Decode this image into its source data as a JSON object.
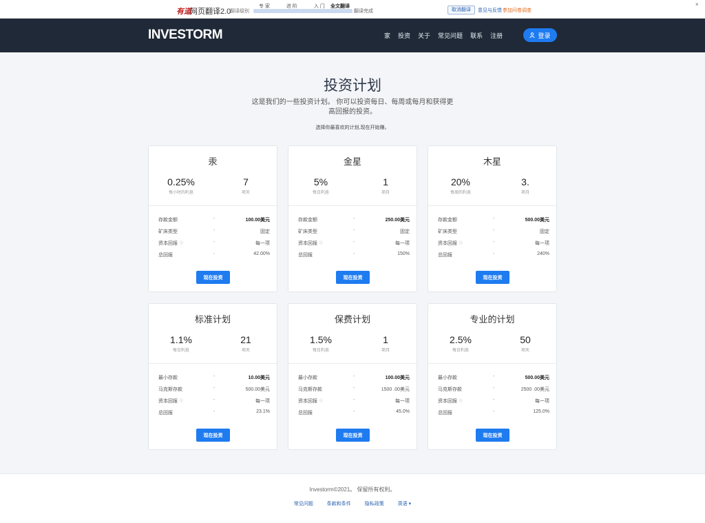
{
  "toolbar": {
    "brand": "有道",
    "brand_sub": "网页翻译2.0",
    "mode": "翻译级别",
    "steps": [
      "专 家",
      "进 阶",
      "入 门"
    ],
    "full_translate": "全文翻译",
    "done": "翻译完成",
    "progress": 1.0,
    "cancel": "取消翻译",
    "feedback": "意见与反馈",
    "survey": "参加问卷调查",
    "close": "×"
  },
  "nav": {
    "logo": "INVESTORM",
    "menu": [
      "家",
      "投资",
      "关于",
      "常见问题",
      "联系",
      "注册"
    ],
    "login": "登录"
  },
  "header": {
    "title": "投资计划",
    "subtitle": "这是我们的一些投资计划。 你可以投资每日、每周或每月和获得更高回报的投资。",
    "choose": "选择你最喜欢的计划,现在开始赚。"
  },
  "plans": [
    {
      "name": "汞",
      "stat1_value": "0.25%",
      "stat1_label": "每小时的利息",
      "stat2_value": "7",
      "stat2_label": "项天",
      "rows": [
        {
          "key": "存款金额",
          "dash": "-",
          "value": "100.00美元",
          "bold": true
        },
        {
          "key": "矿床类型",
          "dash": "-",
          "value": "固定"
        },
        {
          "key": "资本回报",
          "dash": "-",
          "value": "每一项",
          "info": "ⓘ"
        },
        {
          "key": "总回报",
          "dash": "-",
          "value": "42.00%"
        }
      ],
      "button": "现在投资"
    },
    {
      "name": "金星",
      "stat1_value": "5%",
      "stat1_label": "每日利息",
      "stat2_value": "1",
      "stat2_label": "项月",
      "rows": [
        {
          "key": "存款金额",
          "dash": "-",
          "value": "250.00美元",
          "bold": true
        },
        {
          "key": "矿床类型",
          "dash": "-",
          "value": "固定"
        },
        {
          "key": "资本回报",
          "dash": "-",
          "value": "每一项",
          "info": "ⓘ"
        },
        {
          "key": "总回报",
          "dash": "-",
          "value": "150%"
        }
      ],
      "button": "现在投资"
    },
    {
      "name": "木星",
      "stat1_value": "20%",
      "stat1_label": "每周的利息",
      "stat2_value": "3.",
      "stat2_label": "项月",
      "rows": [
        {
          "key": "存款金额",
          "dash": "-",
          "value": "500.00美元",
          "bold": true
        },
        {
          "key": "矿床类型",
          "dash": "-",
          "value": "固定"
        },
        {
          "key": "资本回报",
          "dash": "-",
          "value": "每一项",
          "info": "ⓘ"
        },
        {
          "key": "总回报",
          "dash": "-",
          "value": "240%"
        }
      ],
      "button": "现在投资"
    },
    {
      "name": "标准计划",
      "stat1_value": "1.1%",
      "stat1_label": "每日利息",
      "stat2_value": "21",
      "stat2_label": "项天",
      "rows": [
        {
          "key": "最小存款",
          "dash": "-",
          "value": "10.00美元",
          "bold": true
        },
        {
          "key": "马克斯存款",
          "dash": "-",
          "value": "500.00美元"
        },
        {
          "key": "资本回报",
          "dash": "-",
          "value": "每一项",
          "info": "ⓘ"
        },
        {
          "key": "总回报",
          "dash": "-",
          "value": "23.1%"
        }
      ],
      "button": "现在投资"
    },
    {
      "name": "保费计划",
      "stat1_value": "1.5%",
      "stat1_label": "每日利息",
      "stat2_value": "1",
      "stat2_label": "项月",
      "rows": [
        {
          "key": "最小存款",
          "dash": "-",
          "value": "100.00美元",
          "bold": true
        },
        {
          "key": "马克斯存款",
          "dash": "-",
          "value": "1500 .00美元"
        },
        {
          "key": "资本回报",
          "dash": "-",
          "value": "每一项",
          "info": "ⓘ"
        },
        {
          "key": "总回报",
          "dash": "-",
          "value": "45.0%"
        }
      ],
      "button": "现在投资"
    },
    {
      "name": "专业的计划",
      "stat1_value": "2.5%",
      "stat1_label": "每日利息",
      "stat2_value": "50",
      "stat2_label": "项天",
      "rows": [
        {
          "key": "最小存款",
          "dash": "-",
          "value": "500.00美元",
          "bold": true
        },
        {
          "key": "马克斯存款",
          "dash": "-",
          "value": "2500 .00美元"
        },
        {
          "key": "资本回报",
          "dash": "-",
          "value": "每一项",
          "info": "ⓘ"
        },
        {
          "key": "总回报",
          "dash": "-",
          "value": "125.0%"
        }
      ],
      "button": "现在投资"
    }
  ],
  "footer": {
    "copyright": "Investorm©2021。 保留所有权利。",
    "links": [
      "常见问题",
      "条款和条件",
      "隐私政策",
      "英语 ▾"
    ]
  },
  "colors": {
    "nav_bg": "#1f2937",
    "accent": "#1e7bf0",
    "page_bg": "#f3f5f8"
  }
}
